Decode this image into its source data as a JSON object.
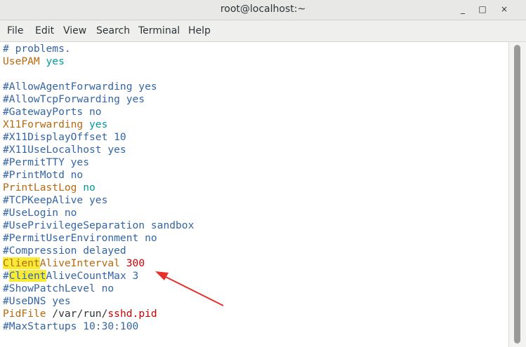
{
  "window": {
    "title": "root@localhost:~",
    "minimize": "_",
    "maximize": "□",
    "close": "×"
  },
  "menubar": {
    "items": [
      "File",
      "Edit",
      "View",
      "Search",
      "Terminal",
      "Help"
    ]
  },
  "terminal_lines": [
    {
      "segments": [
        {
          "text": "# problems.",
          "style": "comment"
        }
      ]
    },
    {
      "segments": [
        {
          "text": "UsePAM",
          "style": "kw2"
        },
        {
          "text": " yes",
          "style": "val"
        }
      ]
    },
    {
      "segments": [
        {
          "text": "",
          "style": "plain"
        }
      ]
    },
    {
      "segments": [
        {
          "text": "#AllowAgentForwarding yes",
          "style": "comment"
        }
      ]
    },
    {
      "segments": [
        {
          "text": "#AllowTcpForwarding yes",
          "style": "comment"
        }
      ]
    },
    {
      "segments": [
        {
          "text": "#GatewayPorts no",
          "style": "comment"
        }
      ]
    },
    {
      "segments": [
        {
          "text": "X11Forwarding",
          "style": "kw2"
        },
        {
          "text": " yes",
          "style": "val"
        }
      ]
    },
    {
      "segments": [
        {
          "text": "#X11DisplayOffset 10",
          "style": "comment"
        }
      ]
    },
    {
      "segments": [
        {
          "text": "#X11UseLocalhost yes",
          "style": "comment"
        }
      ]
    },
    {
      "segments": [
        {
          "text": "#PermitTTY yes",
          "style": "comment"
        }
      ]
    },
    {
      "segments": [
        {
          "text": "#PrintMotd no",
          "style": "comment"
        }
      ]
    },
    {
      "segments": [
        {
          "text": "PrintLastLog",
          "style": "kw2"
        },
        {
          "text": " no",
          "style": "val"
        }
      ]
    },
    {
      "segments": [
        {
          "text": "#TCPKeepAlive yes",
          "style": "comment"
        }
      ]
    },
    {
      "segments": [
        {
          "text": "#UseLogin no",
          "style": "comment"
        }
      ]
    },
    {
      "segments": [
        {
          "text": "#UsePrivilegeSeparation sandbox",
          "style": "comment"
        }
      ]
    },
    {
      "segments": [
        {
          "text": "#PermitUserEnvironment no",
          "style": "comment"
        }
      ]
    },
    {
      "segments": [
        {
          "text": "#Compression delayed",
          "style": "comment"
        }
      ]
    },
    {
      "segments": [
        {
          "text": "Client",
          "style": "kw2 hl"
        },
        {
          "text": "AliveInterval",
          "style": "kw2"
        },
        {
          "text": " ",
          "style": "plain"
        },
        {
          "text": "300",
          "style": "num"
        }
      ]
    },
    {
      "segments": [
        {
          "text": "#",
          "style": "comment"
        },
        {
          "text": "Client",
          "style": "comment hl"
        },
        {
          "text": "AliveCountMax 3",
          "style": "comment"
        }
      ]
    },
    {
      "segments": [
        {
          "text": "#ShowPatchLevel no",
          "style": "comment"
        }
      ]
    },
    {
      "segments": [
        {
          "text": "#UseDNS yes",
          "style": "comment"
        }
      ]
    },
    {
      "segments": [
        {
          "text": "PidFile",
          "style": "kw2"
        },
        {
          "text": " /var/run/",
          "style": "plain"
        },
        {
          "text": "sshd.pid",
          "style": "num"
        }
      ]
    },
    {
      "segments": [
        {
          "text": "#MaxStartups 10:30:100",
          "style": "comment"
        }
      ]
    }
  ],
  "annotation": {
    "type": "red-arrow",
    "color": "#e8302a"
  }
}
